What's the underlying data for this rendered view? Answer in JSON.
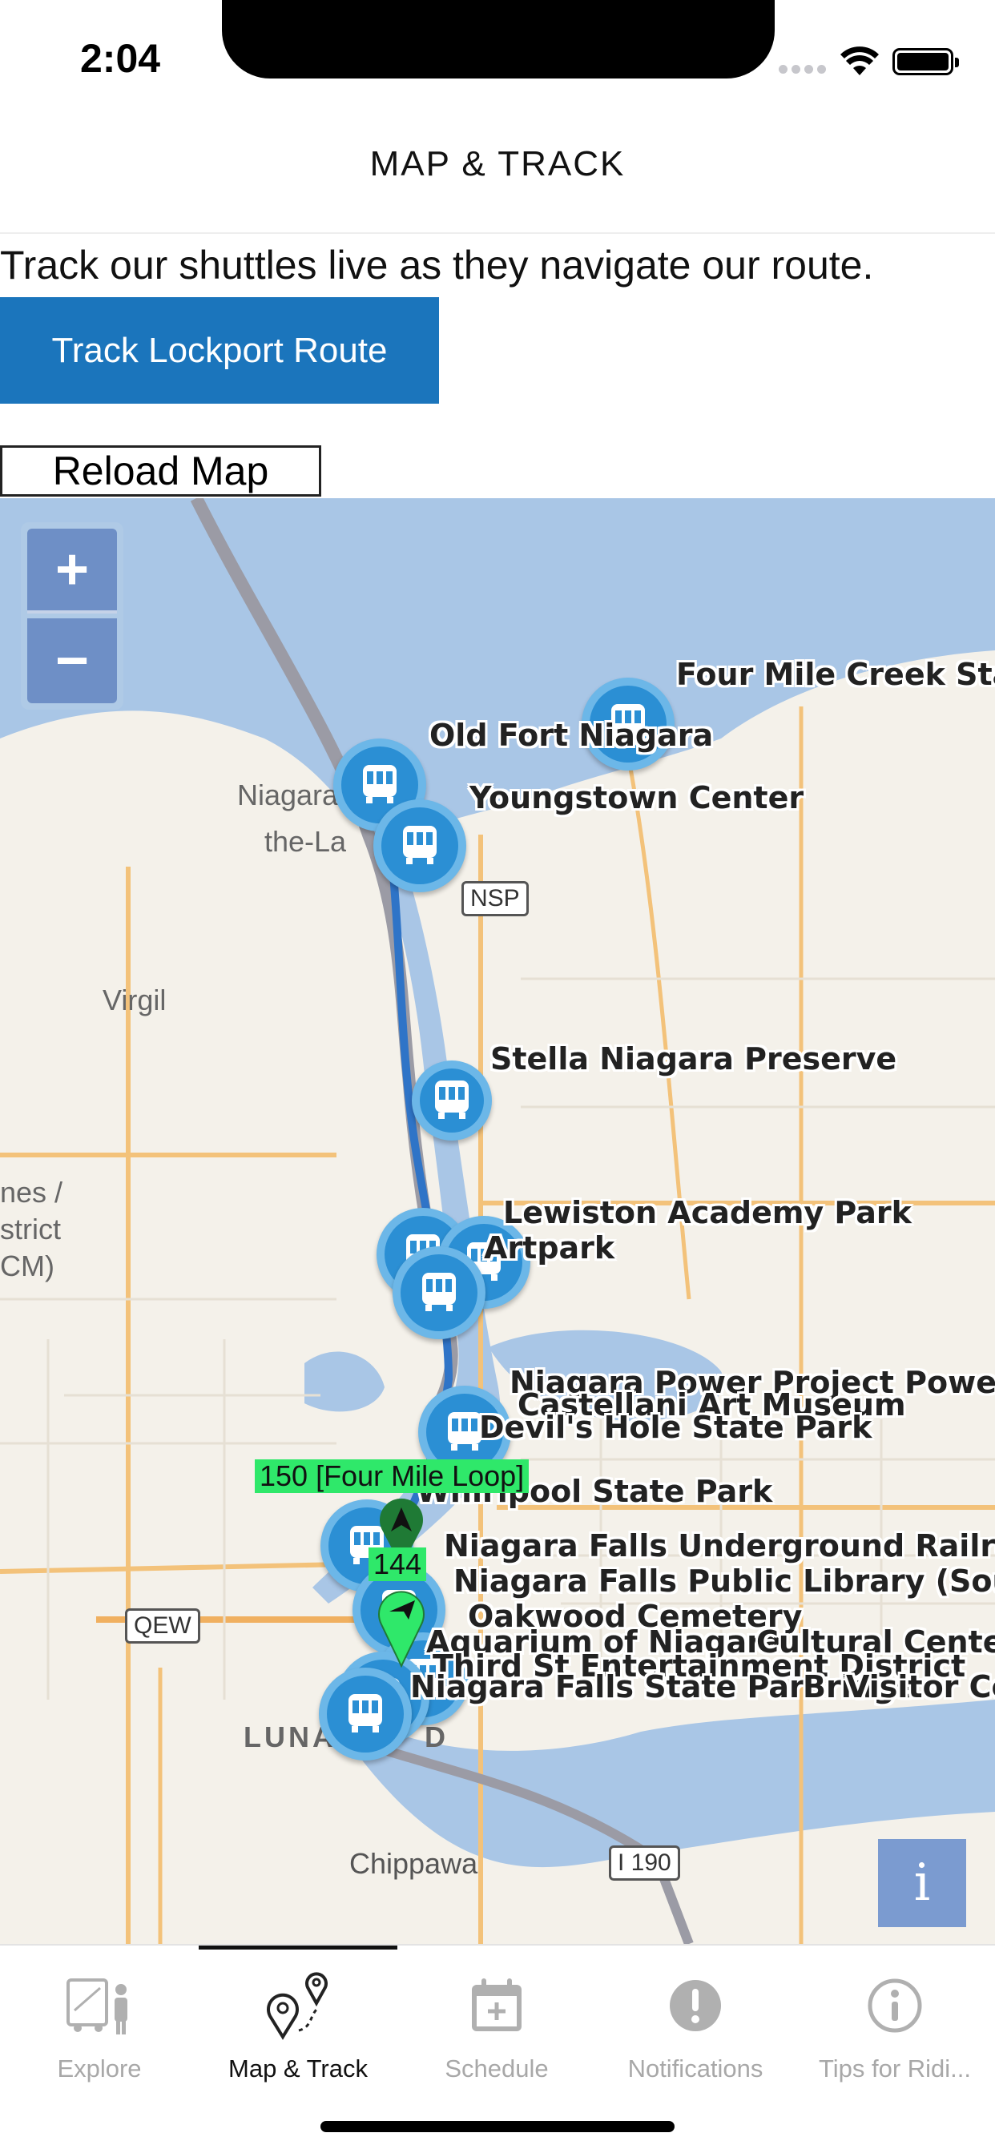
{
  "status": {
    "time": "2:04"
  },
  "nav": {
    "title": "MAP & TRACK"
  },
  "intro": "Track our shuttles live as they navigate our route.",
  "track_button": "Track Lockport Route",
  "reload_button": "Reload Map",
  "map": {
    "zoom_in": "+",
    "zoom_out": "−",
    "info": "i",
    "stops": [
      "Four Mile Creek Stat",
      "Old Fort Niagara",
      "Youngstown Center",
      "Stella Niagara Preserve",
      "Lewiston Academy Park",
      "Artpark",
      "Niagara Power Project Power V",
      "Castellani Art Museum",
      "Devil's Hole State Park",
      "Whirlpool State Park",
      "Niagara Falls Underground Railroa",
      "Niagara Falls Public Library (Sout",
      "Oakwood Cemetery",
      "Aquarium of Niagara",
      "Cultural Center",
      "Third St Entertainment District",
      "Niagara Falls State Park",
      "Bridge",
      "Visitor Ce"
    ],
    "places": [
      "Niagara-",
      "the-La",
      "Virgil",
      "nes /",
      "strict",
      "CM)",
      "LUNA",
      "D",
      "Chippawa"
    ],
    "roads": [
      "NSP",
      "QEW",
      "I 190"
    ],
    "vehicles": [
      {
        "label": "150 [Four Mile Loop]"
      },
      {
        "label": "144"
      }
    ]
  },
  "tabs": [
    {
      "label": "Explore",
      "icon": "bus-stop-icon"
    },
    {
      "label": "Map & Track",
      "icon": "map-pin-icon"
    },
    {
      "label": "Schedule",
      "icon": "calendar-icon"
    },
    {
      "label": "Notifications",
      "icon": "alert-icon"
    },
    {
      "label": "Tips for Ridi...",
      "icon": "info-circle-icon"
    }
  ],
  "colors": {
    "accent": "#1b75bc",
    "stop_marker": "#2b8fd4",
    "vehicle": "#2fe86a",
    "river": "#a9c6e6"
  }
}
